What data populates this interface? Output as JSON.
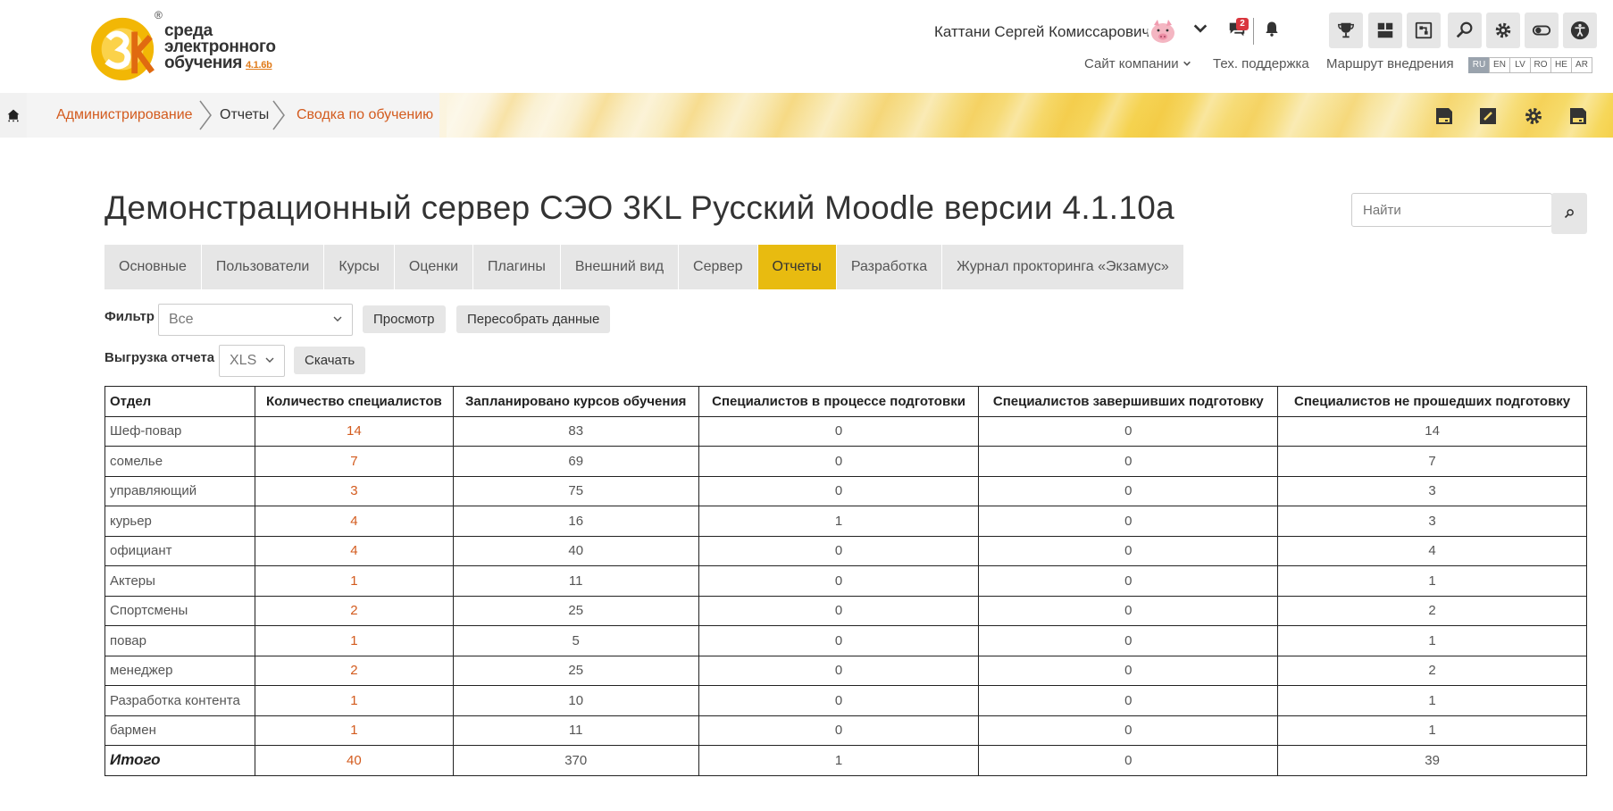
{
  "header": {
    "logo": {
      "line1": "среда",
      "line2": "электронного",
      "line3": "обучения",
      "version": "4.1.6b",
      "reg": "®"
    },
    "user_name": "Каттани Сергей Комиссарович",
    "messages_badge": "2",
    "links": {
      "company_site": "Сайт компании",
      "tech_support": "Тех. поддержка",
      "route": "Маршрут внедрения"
    },
    "languages": [
      "RU",
      "EN",
      "LV",
      "RO",
      "HE",
      "AR"
    ],
    "active_language": "RU"
  },
  "breadcrumb": {
    "items": [
      "Администрирование",
      "Отчеты",
      "Сводка по обучению"
    ]
  },
  "main": {
    "title": "Демонстрационный сервер СЭО 3KL Русский Moodle версии 4.1.10a",
    "search_placeholder": "Найти",
    "tabs": [
      "Основные",
      "Пользователи",
      "Курсы",
      "Оценки",
      "Плагины",
      "Внешний вид",
      "Сервер",
      "Отчеты",
      "Разработка",
      "Журнал прокторинга «Экзамус»"
    ],
    "active_tab": "Отчеты",
    "filter": {
      "label": "Фильтр",
      "value": "Все",
      "view_button": "Просмотр",
      "rebuild_button": "Пересобрать данные"
    },
    "export": {
      "label": "Выгрузка отчета",
      "format": "XLS",
      "download_button": "Скачать"
    }
  },
  "table": {
    "headers": [
      "Отдел",
      "Количество специалистов",
      "Запланировано курсов обучения",
      "Специалистов в процессе подготовки",
      "Специалистов завершивших подготовку",
      "Специалистов не прошедших подготовку"
    ],
    "rows": [
      [
        "Шеф-повар",
        "14",
        "83",
        "0",
        "0",
        "14"
      ],
      [
        "сомелье",
        "7",
        "69",
        "0",
        "0",
        "7"
      ],
      [
        "управляющий",
        "3",
        "75",
        "0",
        "0",
        "3"
      ],
      [
        "курьер",
        "4",
        "16",
        "1",
        "0",
        "3"
      ],
      [
        "официант",
        "4",
        "40",
        "0",
        "0",
        "4"
      ],
      [
        "Актеры",
        "1",
        "11",
        "0",
        "0",
        "1"
      ],
      [
        "Спортсмены",
        "2",
        "25",
        "0",
        "0",
        "2"
      ],
      [
        "повар",
        "1",
        "5",
        "0",
        "0",
        "1"
      ],
      [
        "менеджер",
        "2",
        "25",
        "0",
        "0",
        "2"
      ],
      [
        "Разработка контента",
        "1",
        "10",
        "0",
        "0",
        "1"
      ],
      [
        "бармен",
        "1",
        "11",
        "0",
        "0",
        "1"
      ]
    ],
    "total": [
      "Итого",
      "40",
      "370",
      "1",
      "0",
      "39"
    ]
  },
  "colors": {
    "accent": "#e8bb10",
    "link": "#d35b1e",
    "button_bg": "#e6e6e6"
  }
}
